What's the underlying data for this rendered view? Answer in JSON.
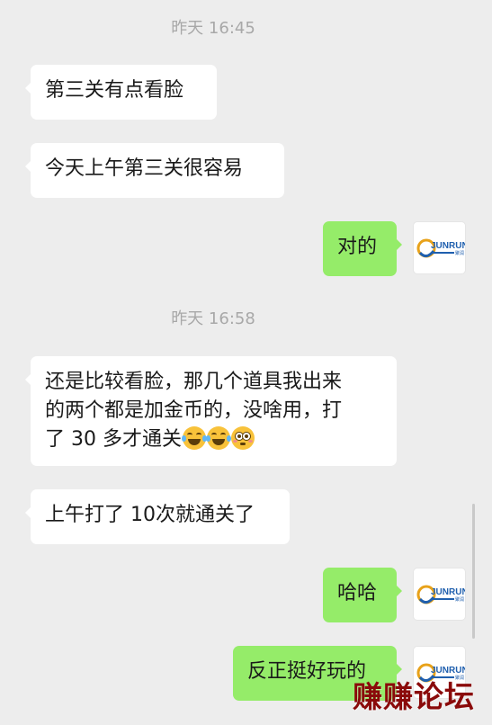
{
  "timestamps": [
    {
      "text": "昨天 16:45"
    },
    {
      "text": "昨天 16:58"
    }
  ],
  "messages": [
    {
      "side": "left",
      "text": "第三关有点看脸"
    },
    {
      "side": "left",
      "text": "今天上午第三关很容易"
    },
    {
      "side": "right",
      "text": "对的"
    },
    {
      "side": "left",
      "text_line1": "还是比较看脸，那几个道具我出来",
      "text_line2": "的两个都是加金币的，没啥用，打",
      "text_line3": "了 30 多才通关",
      "emojis": [
        "face-with-tears-of-joy-icon",
        "face-with-tears-of-joy-icon",
        "flushed-face-icon"
      ]
    },
    {
      "side": "left",
      "text": "上午打了 10次就通关了"
    },
    {
      "side": "right",
      "text": "哈哈"
    },
    {
      "side": "right",
      "text": "反正挺好玩的"
    }
  ],
  "avatar": {
    "label": "JUNRUN",
    "sublabel": "聚润",
    "accent": "#1f5fae",
    "ring": "#e8a21a"
  },
  "watermark": {
    "text": "赚赚论坛"
  },
  "colors": {
    "background": "#ededed",
    "bubble_self": "#95ec69",
    "bubble_other": "#ffffff"
  }
}
